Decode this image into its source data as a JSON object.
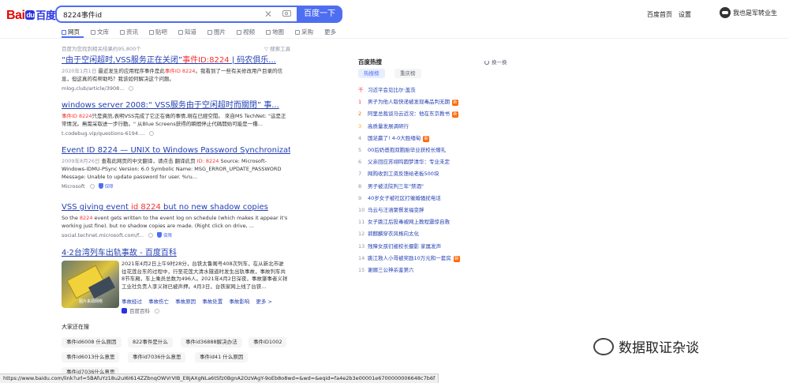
{
  "header": {
    "logo_text_1": "Bai",
    "logo_text_2": "du",
    "logo_text_3": "百度",
    "search_value": "8224事件id",
    "search_button": "百度一下",
    "links": [
      "百度首页",
      "设置"
    ],
    "user_name": "我也是军转业生"
  },
  "tabs": [
    "网页",
    "文库",
    "资讯",
    "贴吧",
    "知道",
    "图片",
    "视频",
    "地图",
    "采购",
    "更多"
  ],
  "result_count": "百度为您找到相关结果约95,800个",
  "tools": "搜索工具",
  "results": [
    {
      "title_pre": "“由于空闲超时,VSS服务正在关闭”",
      "title_em": "事件ID:8224",
      "title_post": " | 码农俱乐...",
      "date": "2020年1月1日",
      "abs_pre": " 最近发生的应用程序事件是此",
      "abs_em": "事件ID 8224",
      "abs_post": "。我看到了一些有关修改用户目录的信息，但这真的有帮助吗？我该如何解决这个问题。",
      "source": "mlog.club/article/3908..."
    },
    {
      "title_pre": "windows server 2008:“ VSS服务由于空闲超时而關閉”",
      "title_em": "",
      "title_post": " 事...",
      "date": "",
      "abs_pre": "",
      "abs_em": "事件ID 8224",
      "abs_post": "只是資訊,表明VSS完成了它正在做的事情,現在已經空閒。 來自MS TechNet: \"這是正常情況。無需采取进一步行動。\" 从Blue Screens获得的瞬間停止代碼開始可能是一種...",
      "source": "t.codebug.vip/questions-6194...."
    },
    {
      "title_pre": "Event ID 8224 — UNIX to Windows Password Synchronizat...",
      "title_em": "",
      "title_post": "",
      "date": "2009年8月26日",
      "abs_pre": "查看此网页的中文翻译，请点击 翻译此页 ",
      "abs_em": "ID: 8224",
      "abs_post": " Source: Microsoft-Windows-IDMU-PSync Version: 6.0 Symbolic Name: MSG_ERROR_UPDATE_PASSWORD Message: Unable to update password for user. %ru...",
      "source": "Microsoft"
    },
    {
      "title_pre": "VSS giving event ",
      "title_em": "id 8224",
      "title_post": " but no new shadow copies",
      "date": "",
      "abs_pre": "So the ",
      "abs_em": "8224",
      "abs_post": " event gets written to the event log on schedule (which makes it appear it's working just fine). but no shadow copies are made. (Right click on drive, ...",
      "source": "social.technet.microsoft.com/f..."
    }
  ],
  "badge_label": "保障",
  "baike": {
    "title": "4·2台湾列车出轨事故 - 百度百科",
    "thumb_caption": "图片来源网络",
    "text": "2021年4月2日上午9时28分，台铁太鲁阁号408次列车，在从新北市驶往花莲台东的过程中，行至花莲大清水隧道时发生出轨事故，事故列车共8节车厢，车上乘员总数为496人。2021年4月2日深夜，事故肇事者义祥工业社负责人李义祥已被声押。4月3日，台铁家网上线了台铁...",
    "links": [
      "事故经过",
      "事故伤亡",
      "事故原因",
      "事故处置",
      "事故影响",
      "更多 >"
    ],
    "source": "百度百科"
  },
  "related": {
    "title": "大家还在搜",
    "chips": [
      "事件id6008 什么原因",
      "822事件是什么",
      "事件id36888解决办法",
      "事件ID1002",
      "事件id6013什么意思",
      "事件id7036什么意思",
      "事件id41 什么原因",
      "事件id7036什么意思"
    ]
  },
  "hot": {
    "title": "百度热搜",
    "refresh": "换一换",
    "tabs": [
      "热搜榜",
      "重庆榜"
    ],
    "items": [
      {
        "rank": "千",
        "text": "习近平会见比尔·盖茨",
        "new": false
      },
      {
        "rank": "1",
        "text": "男子为他人取快递被发现毒品判无期",
        "new": true
      },
      {
        "rank": "2",
        "text": "阿里总裁谈马云近况：他在东京教书",
        "new": true
      },
      {
        "rank": "3",
        "text": "高质量发展调研行",
        "new": false
      },
      {
        "rank": "4",
        "text": "国足赢了! 4-0大胜缅甸",
        "new": true
      },
      {
        "rank": "5",
        "text": "00后奶爸抱双胞胎毕业获校长赠礼",
        "new": false
      },
      {
        "rank": "6",
        "text": "父亲回应苏翊鸣圆梦清华：专业未定",
        "new": false
      },
      {
        "rank": "7",
        "text": "网购收到工资反馈给老板500块",
        "new": false
      },
      {
        "rank": "8",
        "text": "男子被法院判三年\"禁酒\"",
        "new": false
      },
      {
        "rank": "9",
        "text": "40岁女子被社区打催婚骚扰电话",
        "new": false
      },
      {
        "rank": "10",
        "text": "马云与汪涵聚餐发福变胖",
        "new": false
      },
      {
        "rank": "11",
        "text": "女子跳江后投毒被网上教程震惊自救",
        "new": false
      },
      {
        "rank": "12",
        "text": "郭麒麟穿衣风格向太化",
        "new": false
      },
      {
        "rank": "13",
        "text": "残障女孩们被校长摄影 家属发声",
        "new": false
      },
      {
        "rank": "14",
        "text": "跳江救人小哥被奖励10万元和一套房",
        "new": true
      },
      {
        "rank": "15",
        "text": "谢娜三公神杀鉴第六",
        "new": false
      }
    ]
  },
  "watermark": "数据取证杂谈",
  "statusbar": "https://www.baidu.com/link?url=5BAfuYz18u2uI6I614ZZbnqOWVrVIB_E8jAXgNLa6tSfz0BgnA2OzVAgY-9oEb8o8wd=&wd=&eqid=fa4e2b3e00001e6700000006648c7b6f"
}
